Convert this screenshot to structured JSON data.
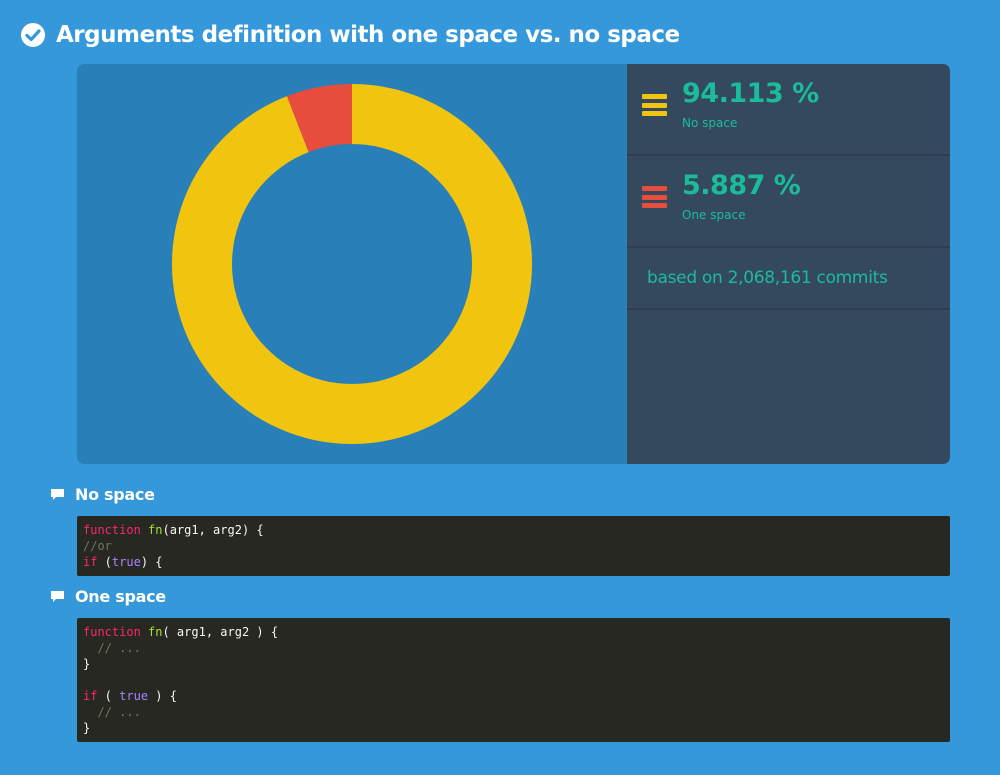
{
  "header": {
    "title": "Arguments definition with one space vs. no space"
  },
  "colors": {
    "background": "#3498db",
    "no_space": "#f1c40f",
    "one_space": "#e74c3c",
    "stat_text": "#1abc9c"
  },
  "chart_data": {
    "type": "pie",
    "donut": true,
    "slices": [
      {
        "name": "No space",
        "value": 94.113,
        "color": "#f1c40f"
      },
      {
        "name": "One space",
        "value": 5.887,
        "color": "#e74c3c"
      }
    ]
  },
  "stats": {
    "no_space": {
      "value": "94.113 %",
      "label": "No space",
      "icon": "legend-bars-icon"
    },
    "one_space": {
      "value": "5.887 %",
      "label": "One space",
      "icon": "legend-bars-icon"
    },
    "based_on": "based on 2,068,161 commits"
  },
  "sections": {
    "no_space": {
      "heading": "No space",
      "icon": "comment-icon",
      "code": [
        [
          [
            "kw",
            "function"
          ],
          [
            "txt",
            " "
          ],
          [
            "fn",
            "fn"
          ],
          [
            "txt",
            "(arg1, arg2) {"
          ]
        ],
        [
          [
            "cm",
            "//or"
          ]
        ],
        [
          [
            "kw",
            "if"
          ],
          [
            "txt",
            " ("
          ],
          [
            "bool",
            "true"
          ],
          [
            "txt",
            ") {"
          ]
        ]
      ]
    },
    "one_space": {
      "heading": "One space",
      "icon": "comment-icon",
      "code": [
        [
          [
            "kw",
            "function"
          ],
          [
            "txt",
            " "
          ],
          [
            "fn",
            "fn"
          ],
          [
            "txt",
            "( arg1, arg2 ) {"
          ]
        ],
        [
          [
            "cm",
            "  // ..."
          ]
        ],
        [
          [
            "txt",
            "}"
          ]
        ],
        [
          [
            "txt",
            ""
          ]
        ],
        [
          [
            "kw",
            "if"
          ],
          [
            "txt",
            " ( "
          ],
          [
            "bool",
            "true"
          ],
          [
            "txt",
            " ) {"
          ]
        ],
        [
          [
            "cm",
            "  // ..."
          ]
        ],
        [
          [
            "txt",
            "}"
          ]
        ]
      ]
    }
  }
}
